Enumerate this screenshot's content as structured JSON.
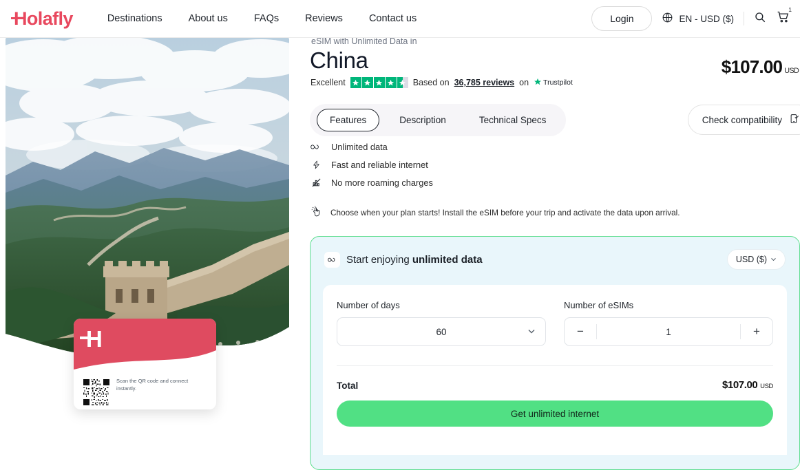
{
  "header": {
    "logo_text": "Holafly",
    "nav": [
      {
        "label": "Destinations"
      },
      {
        "label": "About us"
      },
      {
        "label": "FAQs"
      },
      {
        "label": "Reviews"
      },
      {
        "label": "Contact us"
      }
    ],
    "login_label": "Login",
    "locale_label": "EN - USD ($)",
    "globe_icon": "globe-icon",
    "search_icon": "search-icon",
    "cart_icon": "cart-icon",
    "cart_count": "1"
  },
  "hero": {
    "image_alt": "Great Wall of China over green mountains",
    "esim_card": {
      "logo_letter": "H",
      "caption": "Scan the QR code and connect instantly.",
      "qr_alt": "qr-code"
    }
  },
  "product": {
    "eyebrow": "eSIM with Unlimited Data in",
    "title": "China",
    "price": "$107.00",
    "price_currency": "USD",
    "rating": {
      "label": "Excellent",
      "stars_filled": 4.5,
      "based_on_prefix": "Based on",
      "reviews_count": "36,785 reviews",
      "on_text": "on",
      "platform": "Trustpilot"
    },
    "tabs": [
      {
        "label": "Features",
        "active": true
      },
      {
        "label": "Description",
        "active": false
      },
      {
        "label": "Technical Specs",
        "active": false
      }
    ],
    "check_compatibility_label": "Check compatibility",
    "check_compatibility_icon": "phone-check-icon",
    "features": [
      {
        "icon": "infinity-icon",
        "label": "Unlimited data"
      },
      {
        "icon": "lightning-icon",
        "label": "Fast and reliable internet"
      },
      {
        "icon": "no-roaming-icon",
        "label": "No more roaming charges"
      }
    ],
    "note": {
      "icon": "tap-hand-icon",
      "text": "Choose when your plan starts! Install the eSIM before your trip and activate the data upon arrival."
    }
  },
  "purchase": {
    "heading_prefix": "Start enjoying ",
    "heading_bold": "unlimited data",
    "heading_icon": "infinity-icon",
    "currency_selector": "USD ($)",
    "days_label": "Number of days",
    "days_value": "60",
    "esims_label": "Number of eSIMs",
    "esims_value": "1",
    "decrement_label": "−",
    "increment_label": "+",
    "total_label": "Total",
    "total_price": "$107.00",
    "total_currency": "USD",
    "cta_label": "Get unlimited internet"
  },
  "colors": {
    "brand_red": "#e8485e",
    "cta_green": "#51e084",
    "card_bg": "#e9f6fb",
    "card_border": "#5ede8f",
    "trustpilot_green": "#00b67a"
  }
}
